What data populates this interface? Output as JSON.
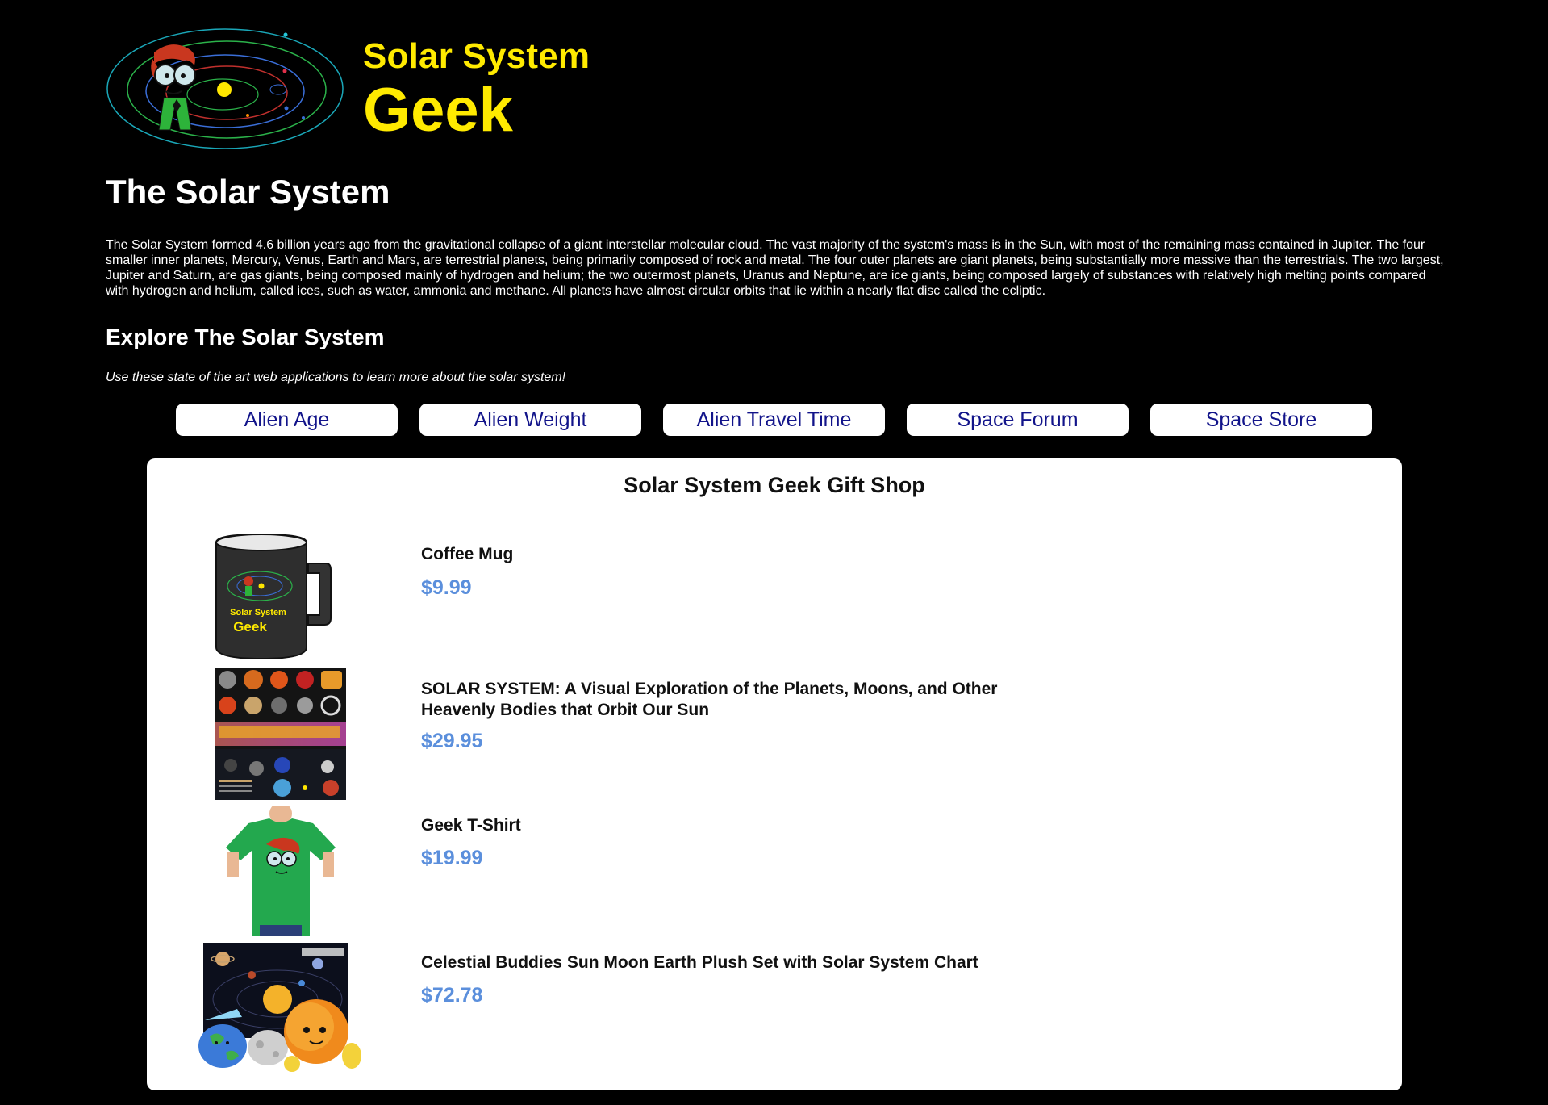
{
  "logo": {
    "line1": "Solar System",
    "line2": "Geek"
  },
  "page": {
    "title": "The Solar System",
    "intro": "The Solar System formed 4.6 billion years ago from the gravitational collapse of a giant interstellar molecular cloud. The vast majority of the system's mass is in the Sun, with most of the remaining mass contained in Jupiter. The four smaller inner planets, Mercury, Venus, Earth and Mars, are terrestrial planets, being primarily composed of rock and metal. The four outer planets are giant planets, being substantially more massive than the terrestrials. The two largest, Jupiter and Saturn, are gas giants, being composed mainly of hydrogen and helium; the two outermost planets, Uranus and Neptune, are ice giants, being composed largely of substances with relatively high melting points compared with hydrogen and helium, called ices, such as water, ammonia and methane. All planets have almost circular orbits that lie within a nearly flat disc called the ecliptic."
  },
  "explore": {
    "title": "Explore The Solar System",
    "subtitle": "Use these state of the art web applications to learn more about the solar system!"
  },
  "nav": [
    {
      "label": "Alien Age"
    },
    {
      "label": "Alien Weight"
    },
    {
      "label": "Alien Travel Time"
    },
    {
      "label": "Space Forum"
    },
    {
      "label": "Space Store"
    }
  ],
  "shop": {
    "title": "Solar System Geek Gift Shop",
    "items": [
      {
        "name": "Coffee Mug",
        "price": "$9.99",
        "image": "coffee-mug-image"
      },
      {
        "name": "SOLAR SYSTEM: A Visual Exploration of the Planets, Moons, and Other Heavenly Bodies that Orbit Our Sun",
        "price": "$29.95",
        "image": "book-cover-image"
      },
      {
        "name": "Geek T-Shirt",
        "price": "$19.99",
        "image": "tshirt-image"
      },
      {
        "name": "Celestial Buddies Sun Moon Earth Plush Set with Solar System Chart",
        "price": "$72.78",
        "image": "plush-set-image"
      }
    ],
    "mug_print": {
      "line1": "Solar System",
      "line2": "Geek"
    }
  },
  "colors": {
    "background": "#000000",
    "logo_yellow": "#ffea00",
    "nav_text": "#12148a",
    "price_blue": "#5b8fdc"
  }
}
